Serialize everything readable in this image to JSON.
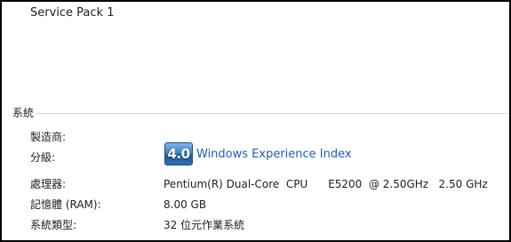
{
  "os": {
    "service_pack": "Service Pack 1"
  },
  "system": {
    "section_title": "系統",
    "manufacturer_label": "製造商:",
    "rating_label": "分級:",
    "rating_score": "4.0",
    "rating_link": "Windows Experience Index",
    "processor_label": "處理器:",
    "processor_value": "Pentium(R) Dual-Core  CPU      E5200  @ 2.50GHz   2.50 GHz",
    "memory_label": "記憶體 (RAM):",
    "memory_value": "8.00 GB",
    "system_type_label": "系統類型:",
    "system_type_value": "32 位元作業系統"
  },
  "colors": {
    "link": "#1e5fb8",
    "badge": "#3c7fc2",
    "section_rule": "#d8d8d8",
    "frame_border": "#000000"
  },
  "icons": {
    "rating_badge": "windows-experience-index-badge"
  }
}
